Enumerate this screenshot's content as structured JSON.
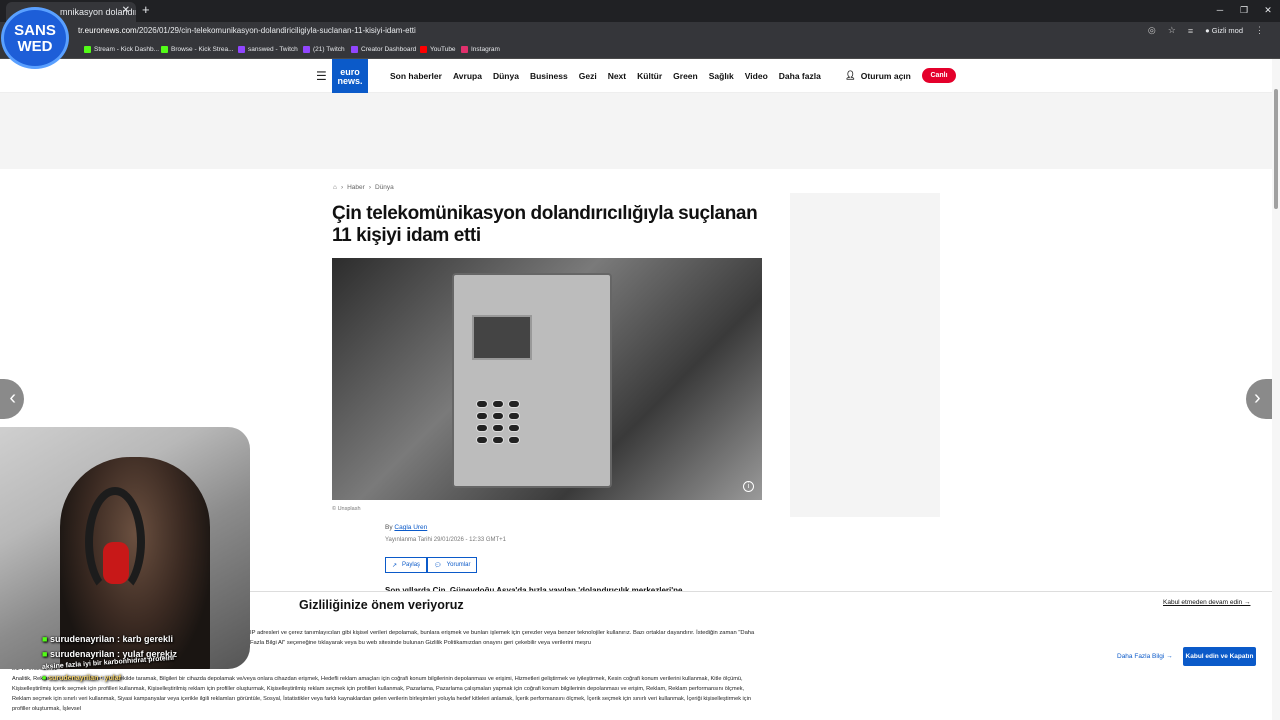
{
  "browser": {
    "tab_title": "mnikasyon dolandır",
    "url_host": "tr.euronews.com",
    "url_path": "/2026/01/29/cin-telekomunikasyon-dolandiriciligiyla-suclanan-11-kisiyi-idam-etti",
    "incognito_label": "Gizli mod",
    "bookmarks": [
      {
        "label": "Stream - Kick Dashb...",
        "color": "#53fc18"
      },
      {
        "label": "Browse - Kick Strea...",
        "color": "#53fc18"
      },
      {
        "label": "sanswed - Twitch",
        "color": "#9146ff"
      },
      {
        "label": "(21) Twitch",
        "color": "#9146ff"
      },
      {
        "label": "Creator Dashboard",
        "color": "#9146ff"
      },
      {
        "label": "YouTube",
        "color": "#ff0000"
      },
      {
        "label": "Instagram",
        "color": "#e1306c"
      }
    ]
  },
  "overlay": {
    "logo_line1": "SANS",
    "logo_line2": "WED"
  },
  "header": {
    "logo_top": "euro",
    "logo_bottom": "news.",
    "nav": [
      "Son haberler",
      "Avrupa",
      "Dünya",
      "Business",
      "Gezi",
      "Next",
      "Kültür",
      "Green",
      "Sağlık",
      "Video",
      "Daha fazla"
    ],
    "signin": "Oturum açın",
    "live": "Canlı"
  },
  "article": {
    "breadcrumb": [
      "Haber",
      "Dünya"
    ],
    "title": "Çin telekomünikasyon dolandırıcılığıyla suçlanan 11 kişiyi idam etti",
    "image_credit": "© Unsplash",
    "by_prefix": "By",
    "author": "Cagla Uren",
    "published": "Yayınlanma Tarihi 29/01/2026 - 12:33 GMT+1",
    "share_label": "Paylaş",
    "comments_label": "Yorumlar",
    "lede": "Son yıllarda Çin, Güneydoğu Asya'da hızla yayılan 'dolandırıcılık merkezleri'ne"
  },
  "consent": {
    "title": "Gizliliğinize önem veriyoruz",
    "decline": "Kabul etmeden devam edin →",
    "paragraph1": "IP adresleri ve çerez tanımlayıcıları gibi kişisel verileri depolamak, bunlara erişmek ve bunları işlemek için çerezler veya benzer teknolojiler kullanırız. Bazı ortaklar dayandırır. İstediğin zaman \"Daha Fazla Bilgi Al\" seçeneğine tıklayarak veya bu web sitesinde bulunan Gizlilik Politikamızdan onayını geri çekebilir veya verilerini meşru",
    "fragment": "Biz ve ortaklarımız",
    "paragraph2": "Analitik, Reklamcılık, Kesin özellikleri aktif şekilde taramak, Bilgileri bir cihazda depolamak ve/veya onlara cihazdan erişmek, Hedefli reklam amaçları için coğrafi konum bilgilerinin depolanması ve erişimi, Hizmetleri geliştirmek ve iyileştirmek, Kesin coğrafi konum verilerini kullanmak, Kitle ölçümü, Kişiselleştirilmiş içerik seçmek için profilleri kullanmak, Kişiselleştirilmiş reklam için profiller oluşturmak, Kişiselleştirilmiş reklam seçmek için profilleri kullanmak, Pazarlama, Pazarlama çalışmaları yapmak için coğrafi konum bilgilerinin depolanması ve erişim, Reklam, Reklam performansını ölçmek, Reklam seçmek için sınırlı veri kullanmak, Siyasi kampanyalar veya içerikle ilgili reklamları görüntüle, Sosyal, İstatistikler veya farklı kaynaklardan gelen verilerin birleşimleri yoluyla hedef kitleleri anlamak, İçerik performansını ölçmek, İçerik seçmek için sınırlı veri kullanmak, İçeriği kişiselleştirmek için profiller oluşturmak, İşlevsel",
    "more_info": "Daha Fazla Bilgi →",
    "accept": "Kabul edin ve Kapatın"
  },
  "chat": [
    {
      "user": "surudenayrilan",
      "message": "karb gerekli"
    },
    {
      "user": "surudenayrilan",
      "message": "yulaf gerekiz"
    },
    {
      "user": "",
      "message": "aksine fazla iyi bir karbonhidrat proteini"
    },
    {
      "user": "surudenayrilan",
      "message": "yulaf"
    }
  ]
}
